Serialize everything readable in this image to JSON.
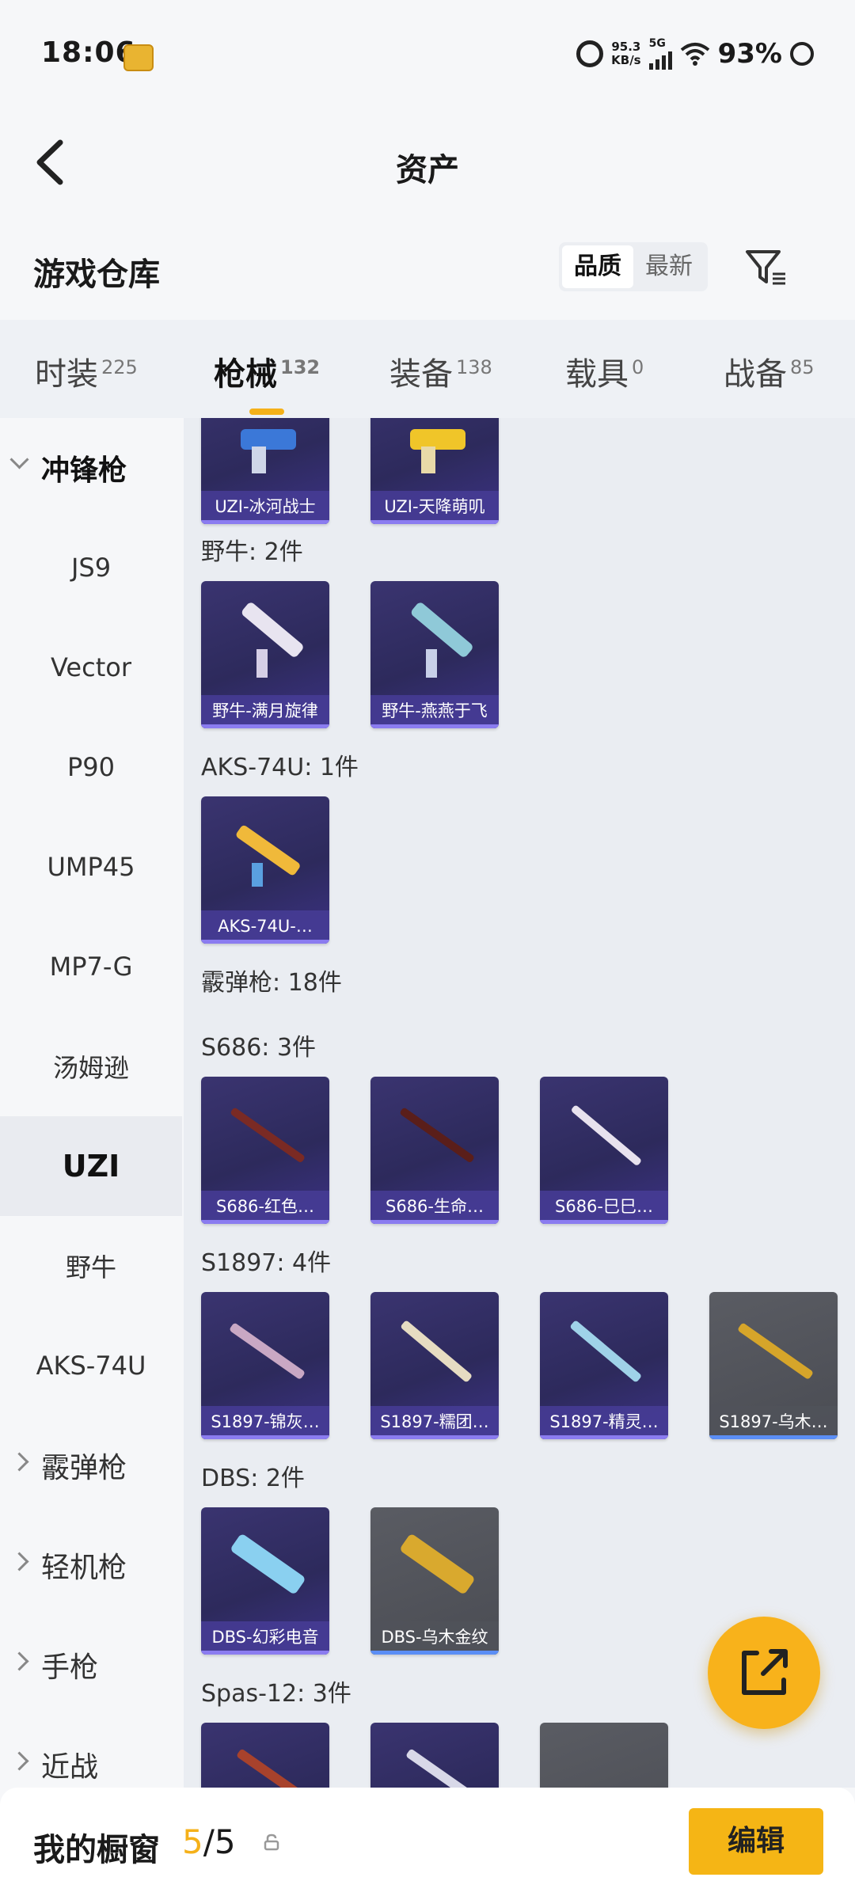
{
  "status": {
    "time": "18:06",
    "netspeed_value": "95.3",
    "netspeed_unit": "KB/s",
    "network": "5G",
    "battery": "93%"
  },
  "header": {
    "title": "资产"
  },
  "warehouse": {
    "title": "游戏仓库",
    "sort_options": [
      "品质",
      "最新"
    ],
    "active_sort": "品质"
  },
  "tabs": [
    {
      "label": "时装",
      "count": "225"
    },
    {
      "label": "枪械",
      "count": "132",
      "active": true
    },
    {
      "label": "装备",
      "count": "138"
    },
    {
      "label": "载具",
      "count": "0"
    },
    {
      "label": "战备",
      "count": "85"
    }
  ],
  "sidebar": {
    "items": [
      "冲锋枪",
      "JS9",
      "Vector",
      "P90",
      "UMP45",
      "MP7-G",
      "汤姆逊",
      "UZI",
      "野牛",
      "AKS-74U",
      "霰弹枪",
      "轻机枪",
      "手枪",
      "近战"
    ],
    "selected": "UZI"
  },
  "content": {
    "groups": [
      {
        "label": "",
        "items": [
          "UZI-冰河战士",
          "UZI-天降萌叽"
        ]
      },
      {
        "label": "野牛: 2件",
        "items": [
          "野牛-满月旋律",
          "野牛-燕燕于飞"
        ]
      },
      {
        "label": "AKS-74U: 1件",
        "items": [
          "AKS-74U-…"
        ]
      },
      {
        "label": "霰弹枪: 18件",
        "items": []
      },
      {
        "label": "S686: 3件",
        "items": [
          "S686-红色…",
          "S686-生命…",
          "S686-巳巳…"
        ]
      },
      {
        "label": "S1897: 4件",
        "items": [
          "S1897-锦灰…",
          "S1897-糯团…",
          "S1897-精灵…",
          "S1897-乌木…"
        ]
      },
      {
        "label": "DBS: 2件",
        "items": [
          "DBS-幻彩电音",
          "DBS-乌木金纹"
        ]
      },
      {
        "label": "Spas-12: 3件",
        "items": [
          "",
          "",
          ""
        ]
      }
    ]
  },
  "bottom": {
    "title": "我的橱窗",
    "count_current": "5",
    "count_total": "/5",
    "edit_label": "编辑"
  },
  "colors": {
    "accent": "#f5b11a",
    "card_purple": "#3a3470",
    "card_grey": "#55575e"
  }
}
